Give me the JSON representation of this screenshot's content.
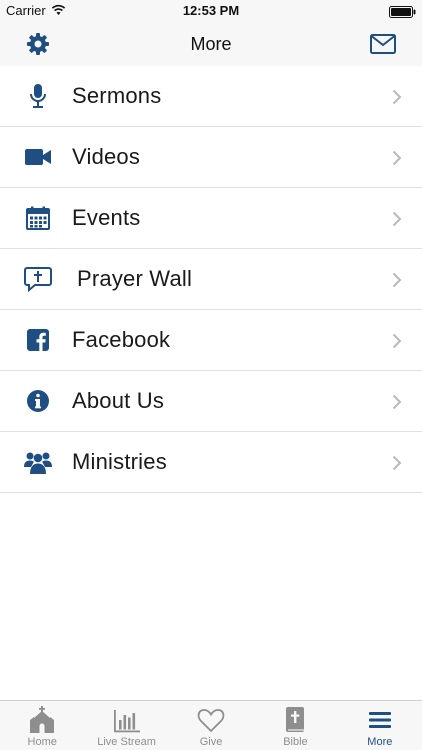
{
  "status_bar": {
    "carrier": "Carrier",
    "time": "12:53 PM"
  },
  "nav": {
    "title": "More"
  },
  "menu": {
    "items": [
      {
        "label": "Sermons"
      },
      {
        "label": "Videos"
      },
      {
        "label": "Events"
      },
      {
        "label": "Prayer Wall"
      },
      {
        "label": "Facebook"
      },
      {
        "label": "About Us"
      },
      {
        "label": "Ministries"
      }
    ]
  },
  "tabs": [
    {
      "label": "Home"
    },
    {
      "label": "Live Stream"
    },
    {
      "label": "Give"
    },
    {
      "label": "Bible"
    },
    {
      "label": "More",
      "active": true
    }
  ],
  "colors": {
    "accent": "#1f4f82",
    "tab_inactive": "#8e8e8e",
    "background": "#ffffff",
    "bar": "#f7f7f7"
  }
}
